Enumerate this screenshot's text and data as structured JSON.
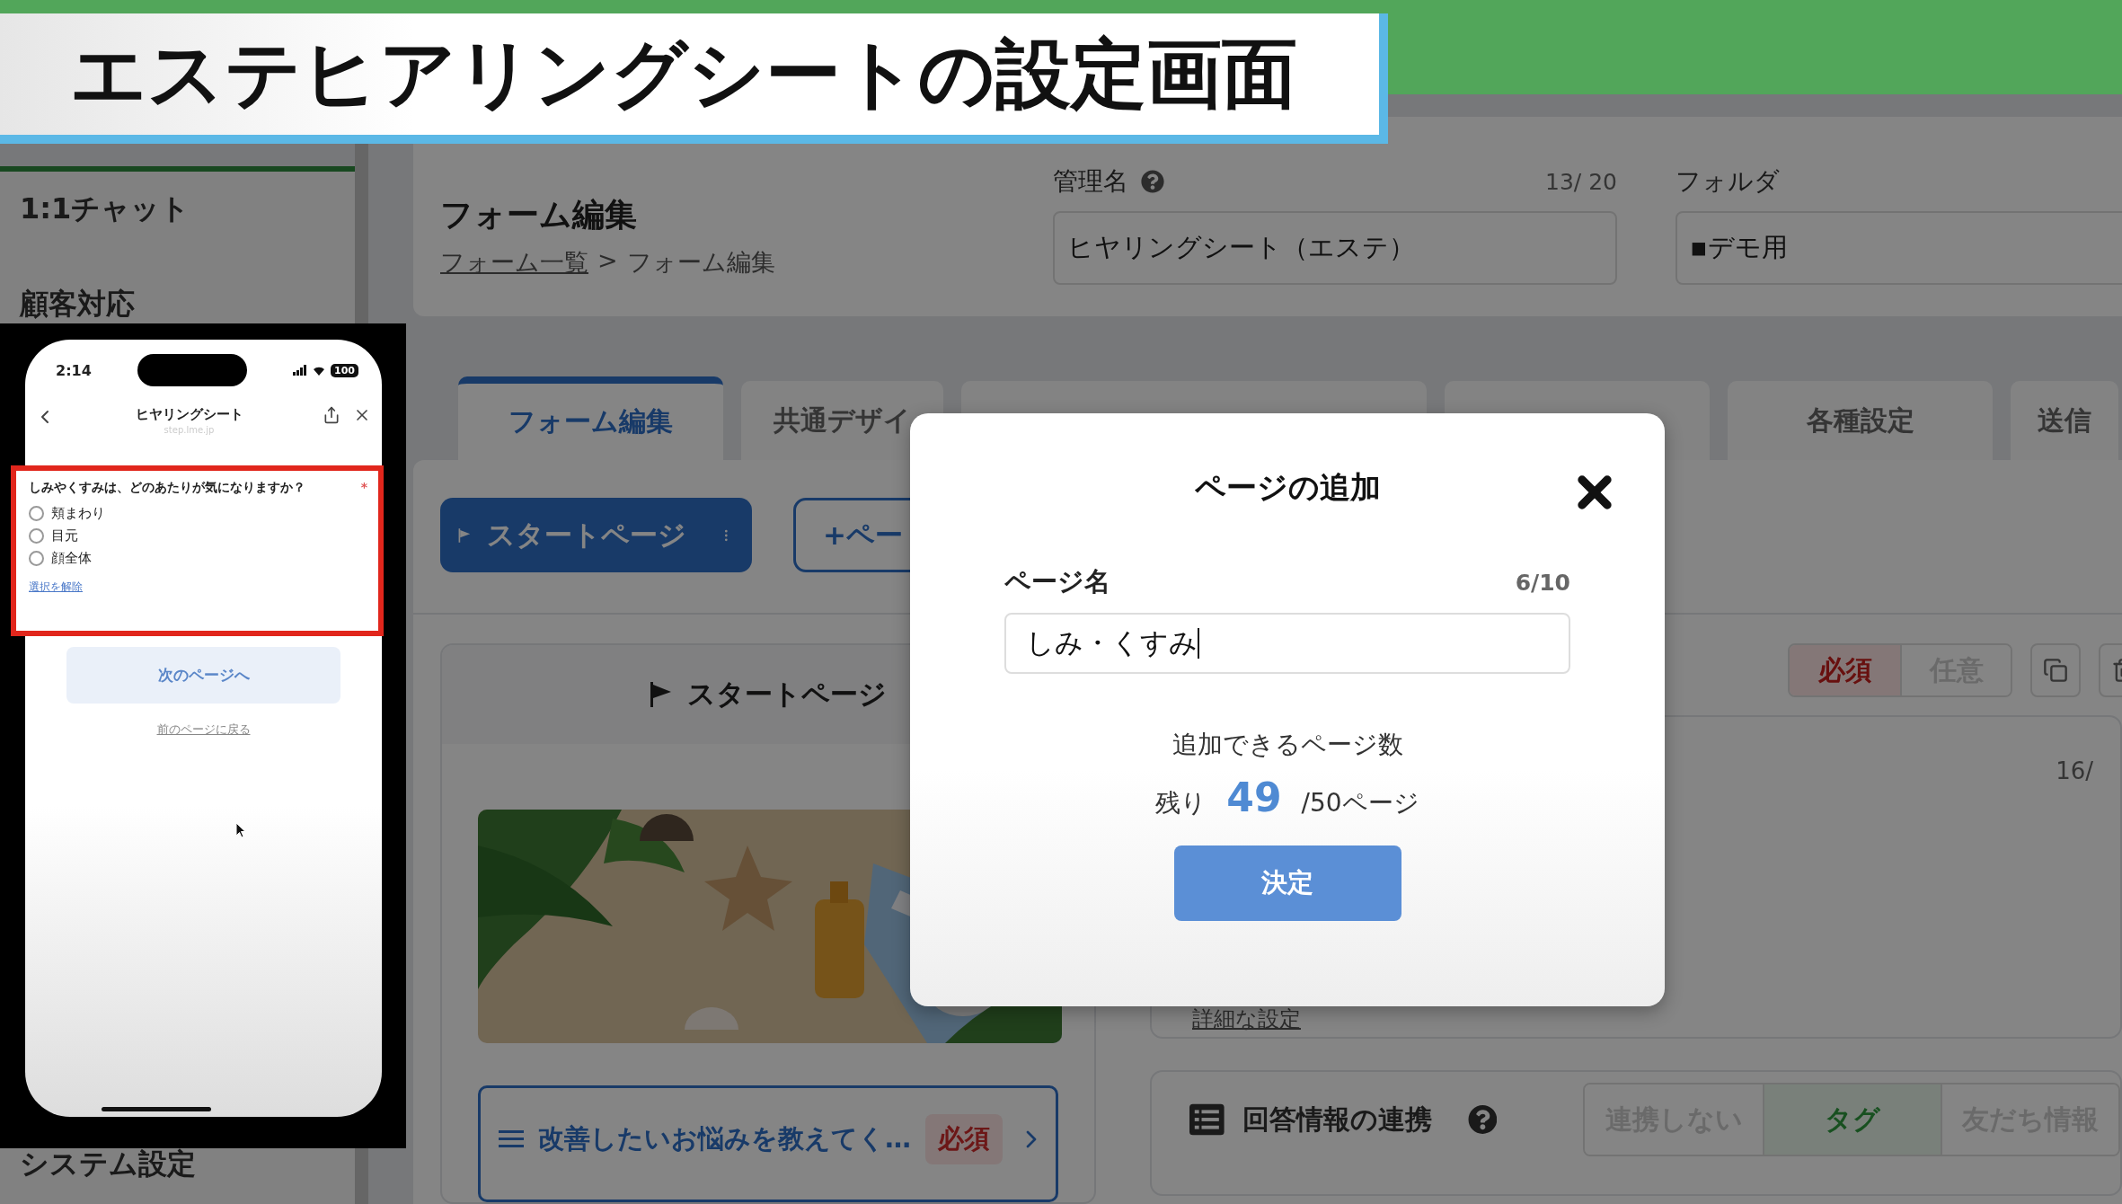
{
  "overlay_title": "エステヒアリングシートの設定画面",
  "sidebar": {
    "items": [
      {
        "label": "1:1チャット"
      },
      {
        "label": "顧客対応"
      },
      {
        "label": "システム設定"
      }
    ]
  },
  "header": {
    "title": "フォーム編集",
    "breadcrumb": {
      "link": "フォーム一覧",
      "separator": ">",
      "current": "フォーム編集"
    },
    "admin_name": {
      "label": "管理名",
      "counter": "13/ 20",
      "value": "ヒヤリングシート（エステ）"
    },
    "folder": {
      "label": "フォルダ",
      "value": "▪デモ用"
    }
  },
  "tabs": [
    {
      "label": "フォーム編集",
      "selected": true
    },
    {
      "label": "共通デザイ",
      "selected": false
    },
    {
      "selected": false
    },
    {
      "selected": false
    },
    {
      "label": "各種設定",
      "selected": false
    },
    {
      "label": "送信",
      "selected": false
    }
  ],
  "page_buttons": [
    {
      "label": "スタートページ",
      "kind": "primary"
    },
    {
      "label": "+ペー",
      "kind": "outline"
    }
  ],
  "start_page": {
    "title": "スタートページ",
    "question": {
      "text": "改善したいお悩みを教えてく…",
      "badge": "必須"
    }
  },
  "question_settings": {
    "required_toggle": [
      {
        "label": "必須",
        "selected": true
      },
      {
        "label": "任意",
        "selected": false
      }
    ],
    "counter": "16/",
    "detail_link": "詳細な設定"
  },
  "answer_link": {
    "title": "回答情報の連携",
    "options": [
      {
        "label": "連携しない",
        "selected": false
      },
      {
        "label": "タグ",
        "selected": true
      },
      {
        "label": "友だち情報",
        "selected": false
      }
    ]
  },
  "modal": {
    "title": "ページの追加",
    "field_label": "ページ名",
    "counter": "6/10",
    "value": "しみ・くすみ",
    "capacity_label": "追加できるページ数",
    "remaining_prefix": "残り",
    "remaining": "49",
    "remaining_suffix": "/50ページ",
    "submit": "決定"
  },
  "phone": {
    "time": "2:14",
    "battery": "100",
    "title": "ヒヤリングシート",
    "url": "step.lme.jp",
    "question": "しみやくすみは、どのあたりが気になりますか？",
    "required_mark": "*",
    "options": [
      {
        "label": "頬まわり",
        "selected": false
      },
      {
        "label": "目元",
        "selected": false
      },
      {
        "label": "顔全体",
        "selected": false
      }
    ],
    "clear_link": "選択を解除",
    "next_button": "次のページへ",
    "back_link": "前のページに戻る"
  }
}
